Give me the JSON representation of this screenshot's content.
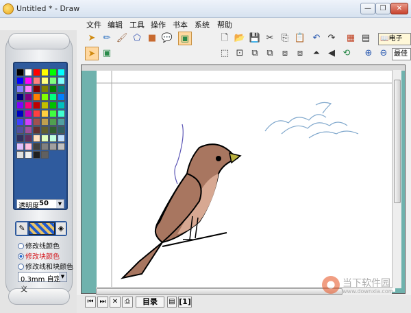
{
  "window": {
    "title": "Untitled * - Draw",
    "min_label": "—",
    "max_label": "❐",
    "close_label": "✕"
  },
  "menu": [
    "文件",
    "编辑",
    "工具",
    "操作",
    "书本",
    "系统",
    "帮助"
  ],
  "left_panel": {
    "palette_colors": [
      "#000000",
      "#ffffff",
      "#ff0000",
      "#ffff00",
      "#00ff00",
      "#00ffff",
      "#0000ff",
      "#ff00ff",
      "#ff8080",
      "#ffff80",
      "#80ff80",
      "#80ffff",
      "#8080ff",
      "#ff80ff",
      "#800000",
      "#808000",
      "#008000",
      "#008080",
      "#000080",
      "#800080",
      "#ff8000",
      "#80ff00",
      "#00ff80",
      "#0080ff",
      "#8000ff",
      "#ff0080",
      "#c00000",
      "#c0c000",
      "#00c000",
      "#00c0c0",
      "#0000c0",
      "#c000c0",
      "#ff4040",
      "#ffd040",
      "#40ff40",
      "#40ffd0",
      "#4040ff",
      "#d040ff",
      "#a05050",
      "#c0a050",
      "#50a050",
      "#50a0a0",
      "#5050a0",
      "#a050a0",
      "#603030",
      "#606030",
      "#306030",
      "#306060",
      "#303060",
      "#603060",
      "#ffe0c0",
      "#e0ffc0",
      "#c0ffe0",
      "#c0e0ff",
      "#e0c0ff",
      "#ffc0e0",
      "#404040",
      "#808080",
      "#a0a0a0",
      "#c0c0c0",
      "#e0e0e0",
      "#f0f0f0",
      "#202020",
      "#606060"
    ],
    "transparency_label": "透明度",
    "transparency_value": "50",
    "radio_options": [
      {
        "label": "修改线颜色",
        "selected": false
      },
      {
        "label": "修改块颜色",
        "selected": true
      },
      {
        "label": "修改线和块颜色",
        "selected": false
      }
    ],
    "line_width": "0.3mm 自定义"
  },
  "toolbar": {
    "ebook_label": "电子",
    "bestfit_label": "最佳"
  },
  "bottom_tabs": {
    "catalog_label": "目录",
    "page_label": "[1]"
  },
  "watermark": {
    "text": "当下软件园",
    "url": "www.downxia.com"
  },
  "colors": {
    "canvas_bg": "#6fb2ad",
    "bird_body": "#a87660",
    "bird_belly": "#d7a892",
    "bird_beak": "#b8b040",
    "doodle_blue": "#7fa7cc",
    "doodle_purple": "#5b55b5"
  }
}
